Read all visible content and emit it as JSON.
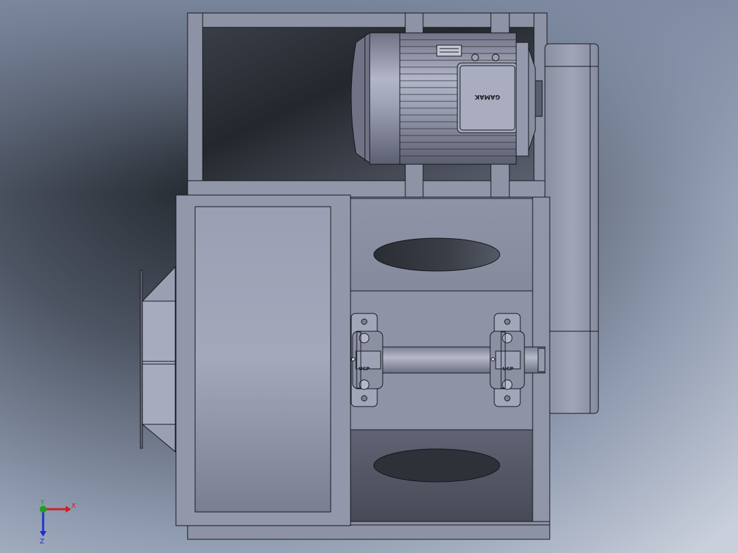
{
  "motor": {
    "brand_label": "GAMAK"
  },
  "bearings": {
    "left_label": "UCP",
    "right_label": "UCP"
  },
  "triad": {
    "x_label": "X",
    "y_label": "Y",
    "z_label": "Z",
    "x_color": "#d21e1e",
    "y_color": "#1ea01e",
    "z_color": "#1e2ed2"
  },
  "colors": {
    "background_light": "#c9cfdb",
    "background_dark": "#2a2e35",
    "steel": "#8b8fa3",
    "steel_light": "#a6aabc",
    "steel_dark": "#4c4f5c",
    "outline": "#14161c"
  }
}
